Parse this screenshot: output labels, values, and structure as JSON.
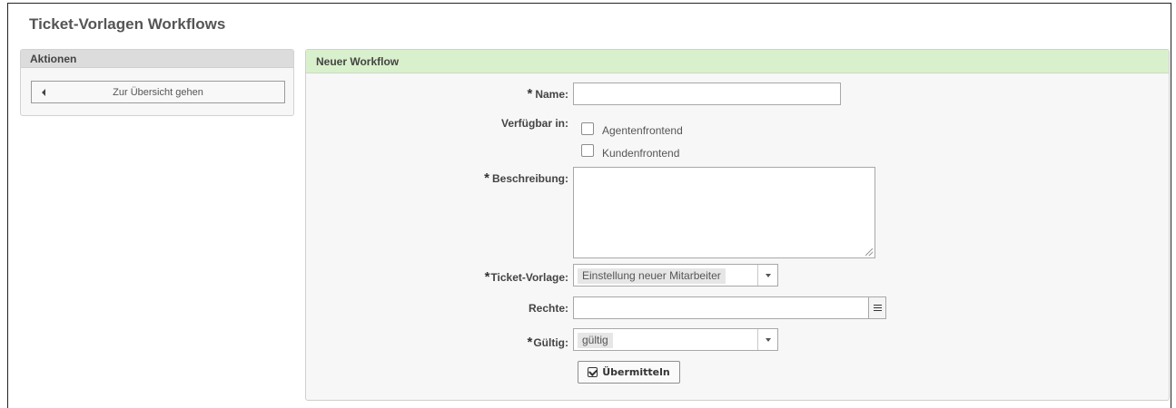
{
  "page": {
    "title": "Ticket-Vorlagen Workflows"
  },
  "sidebar": {
    "header": "Aktionen",
    "overview_button": "Zur Übersicht gehen"
  },
  "form": {
    "header": "Neuer Workflow",
    "required_mark": "*",
    "name": {
      "label": "Name:",
      "value": ""
    },
    "available_in": {
      "label": "Verfügbar in:",
      "options": [
        {
          "label": "Agentenfrontend",
          "checked": false
        },
        {
          "label": "Kundenfrontend",
          "checked": false
        }
      ]
    },
    "description": {
      "label": "Beschreibung:",
      "value": ""
    },
    "ticket_template": {
      "label": "Ticket-Vorlage:",
      "selected": "Einstellung neuer Mitarbeiter"
    },
    "rights": {
      "label": "Rechte:",
      "value": ""
    },
    "valid": {
      "label": "Gültig:",
      "selected": "gültig"
    },
    "submit_label": "Übermitteln"
  },
  "colors": {
    "panel_header_bg": "#d9f0cc",
    "sidebar_header_bg": "#dcdcdc",
    "panel_bg": "#f7f7f7"
  },
  "icons": {
    "back": "caret-left-icon",
    "list": "list-icon",
    "submit": "check-square-icon",
    "dropdown": "chevron-down-icon"
  }
}
